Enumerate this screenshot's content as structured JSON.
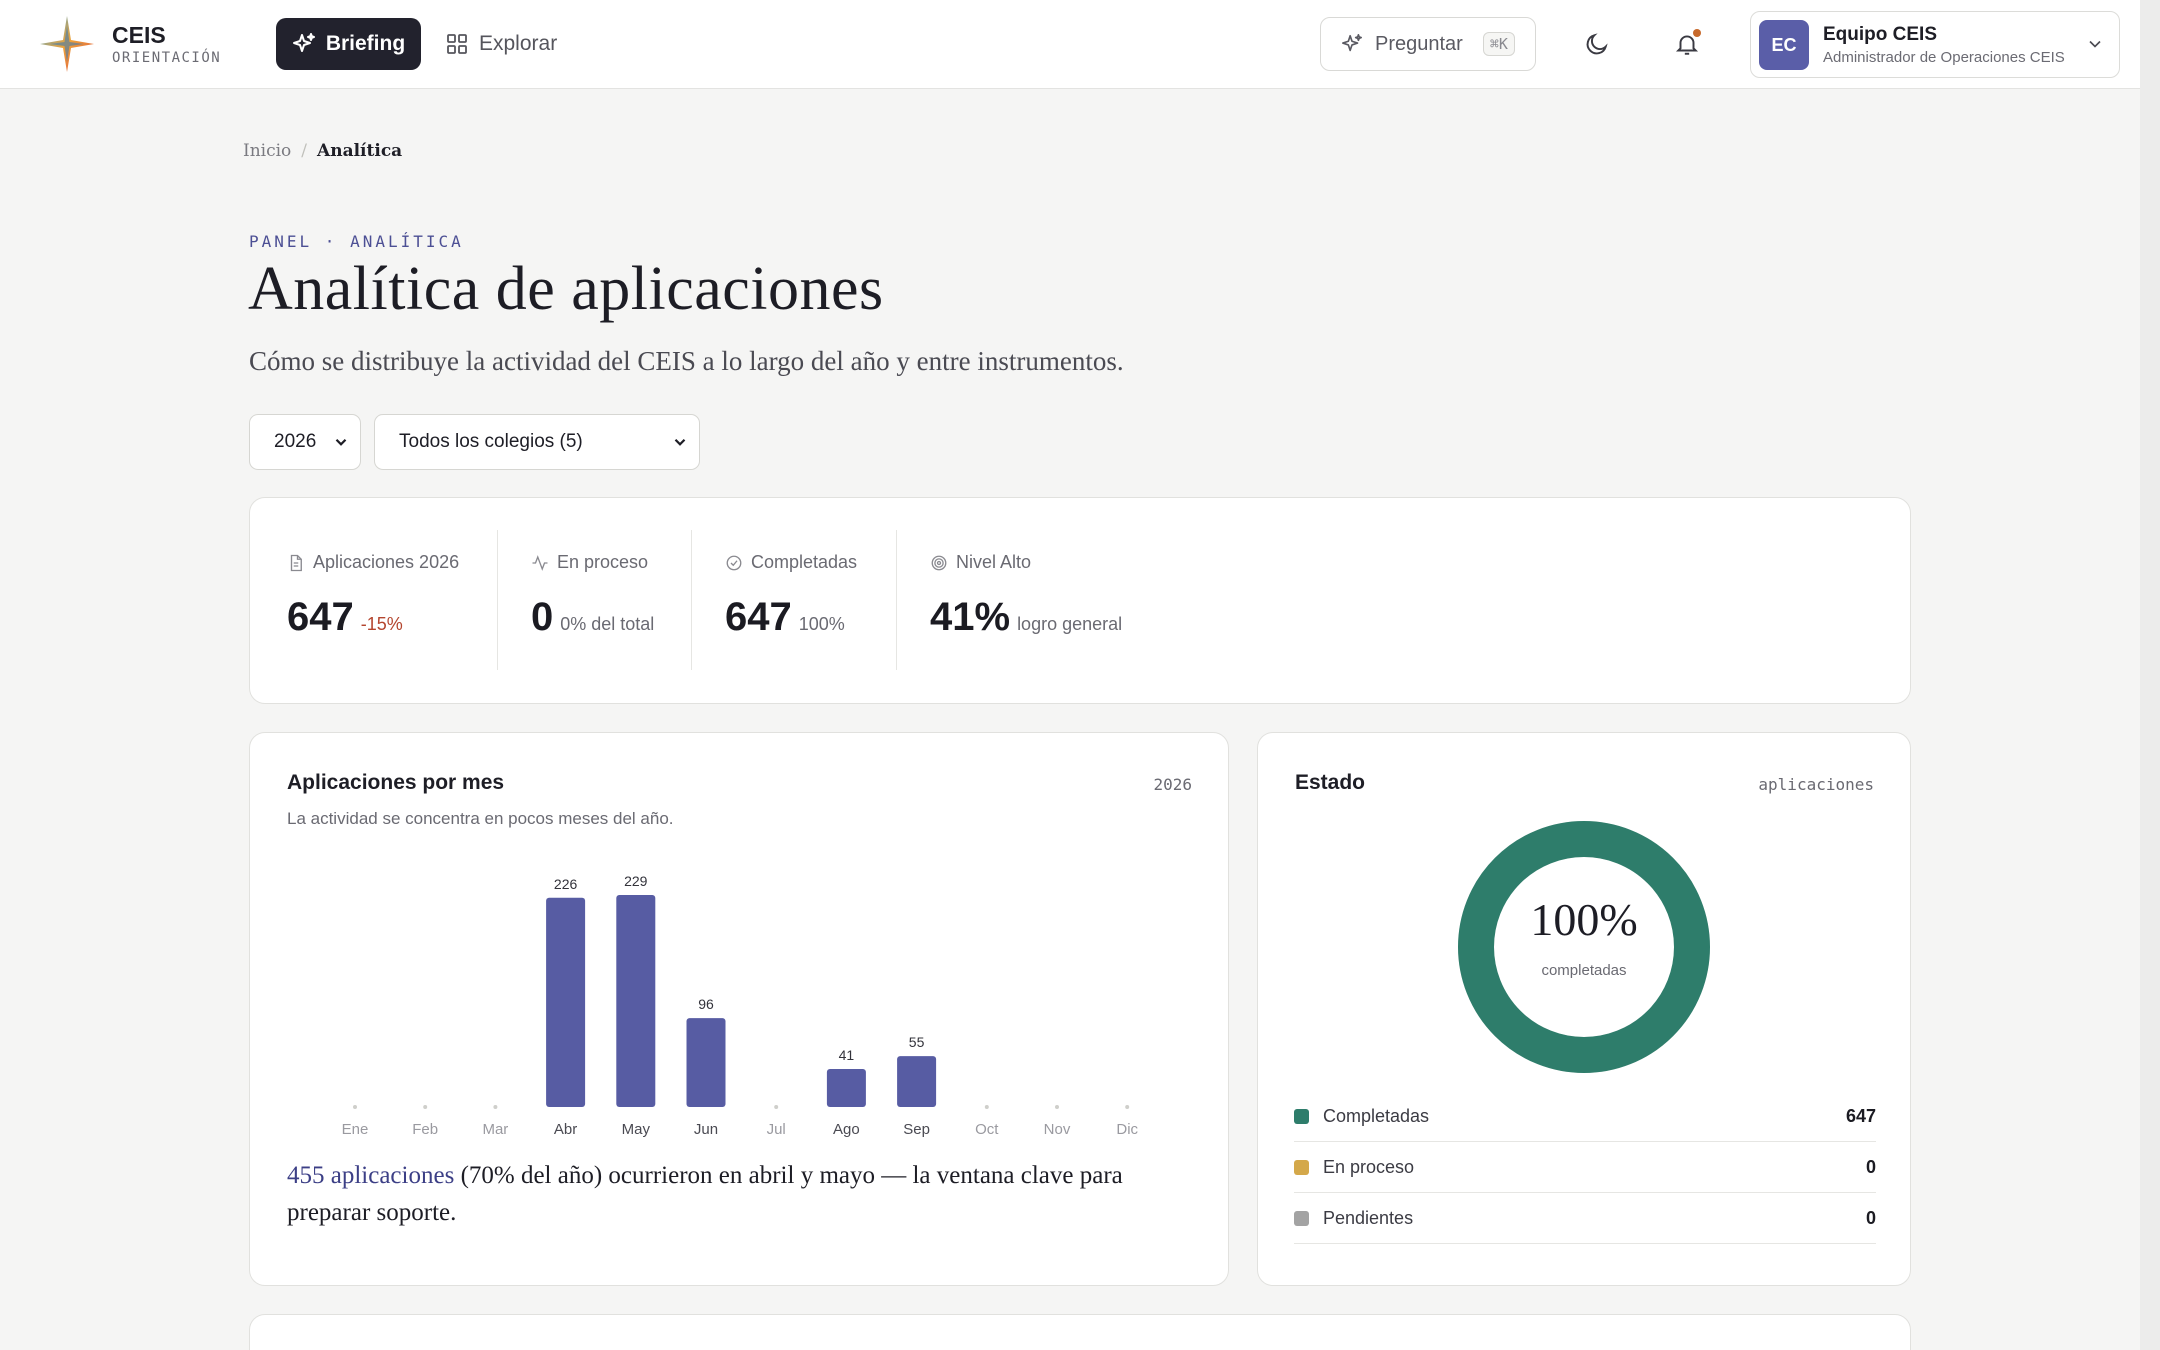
{
  "brand": {
    "name": "CEIS",
    "subtitle": "ORIENTACIÓN"
  },
  "nav": {
    "briefing": "Briefing",
    "explorar": "Explorar"
  },
  "ask": {
    "label": "Preguntar",
    "shortcut": "⌘K"
  },
  "user": {
    "initials": "EC",
    "name": "Equipo CEIS",
    "role": "Administrador de Operaciones CEIS"
  },
  "breadcrumb": {
    "home": "Inicio",
    "separator": "/",
    "current": "Analítica"
  },
  "header": {
    "eyebrow": "PANEL · ANALÍTICA",
    "title": "Analítica de aplicaciones",
    "subtitle": "Cómo se distribuye la actividad del CEIS a lo largo del año y entre instrumentos."
  },
  "filters": {
    "year": "2026",
    "school": "Todos los colegios (5)"
  },
  "stats": [
    {
      "label": "Aplicaciones 2026",
      "value": "647",
      "delta": "-15%"
    },
    {
      "label": "En proceso",
      "value": "0",
      "delta": "0% del total"
    },
    {
      "label": "Completadas",
      "value": "647",
      "delta": "100%"
    },
    {
      "label": "Nivel Alto",
      "value": "41%",
      "delta": "logro general"
    }
  ],
  "monthly": {
    "title": "Aplicaciones por mes",
    "tag": "2026",
    "subtitle": "La actividad se concentra en pocos meses del año.",
    "insight_highlight": "455 aplicaciones",
    "insight_rest": " (70% del año) ocurrieron en abril y mayo — la ventana clave para preparar soporte."
  },
  "chart_data": {
    "type": "bar",
    "categories": [
      "Ene",
      "Feb",
      "Mar",
      "Abr",
      "May",
      "Jun",
      "Jul",
      "Ago",
      "Sep",
      "Oct",
      "Nov",
      "Dic"
    ],
    "values": [
      0,
      0,
      0,
      226,
      229,
      96,
      0,
      41,
      55,
      0,
      0,
      0
    ],
    "color": "#575ca3"
  },
  "status": {
    "title": "Estado",
    "tag": "aplicaciones",
    "percent": "100%",
    "percent_label": "completadas",
    "items": [
      {
        "label": "Completadas",
        "value": "647",
        "color": "#2e7d6b"
      },
      {
        "label": "En proceso",
        "value": "0",
        "color": "#d4a84a"
      },
      {
        "label": "Pendientes",
        "value": "0",
        "color": "#a3a3a3"
      }
    ]
  }
}
